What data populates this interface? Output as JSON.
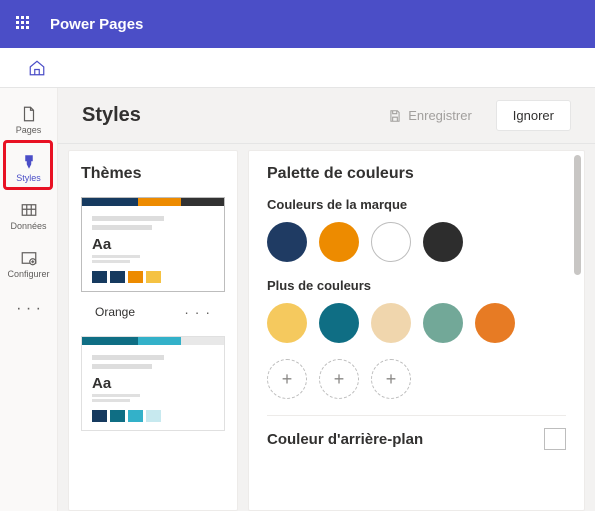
{
  "header": {
    "brand": "Power Pages"
  },
  "nav": {
    "pages": "Pages",
    "styles": "Styles",
    "data": "Données",
    "configure": "Configurer"
  },
  "toolbar": {
    "title": "Styles",
    "save": "Enregistrer",
    "ignore": "Ignorer"
  },
  "themes": {
    "heading": "Thèmes",
    "cards": [
      {
        "topColors": [
          "#163a5f",
          "#ed8b00",
          "#323232"
        ],
        "swatches": [
          "#163a5f",
          "#163a5f",
          "#ed8b00",
          "#f5c242"
        ],
        "name": "Orange",
        "selected": true
      },
      {
        "topColors": [
          "#0f6e84",
          "#33b1c9",
          "#e8e8e8"
        ],
        "swatches": [
          "#163a5f",
          "#0f6e84",
          "#33b1c9",
          "#c7e9ef"
        ],
        "name": "",
        "selected": false
      }
    ]
  },
  "palette": {
    "heading": "Palette de couleurs",
    "brandLabel": "Couleurs de la marque",
    "brandColors": [
      "#1f3b63",
      "#ed8b00",
      "#ffffff",
      "#2d2d2d"
    ],
    "moreLabel": "Plus de couleurs",
    "moreColors": [
      "#f5c95e",
      "#0f6e84",
      "#f0d6ad",
      "#72a898",
      "#e77b24"
    ],
    "addSlots": 3,
    "bgLabel": "Couleur d'arrière-plan",
    "bgColor": "#ffffff"
  }
}
